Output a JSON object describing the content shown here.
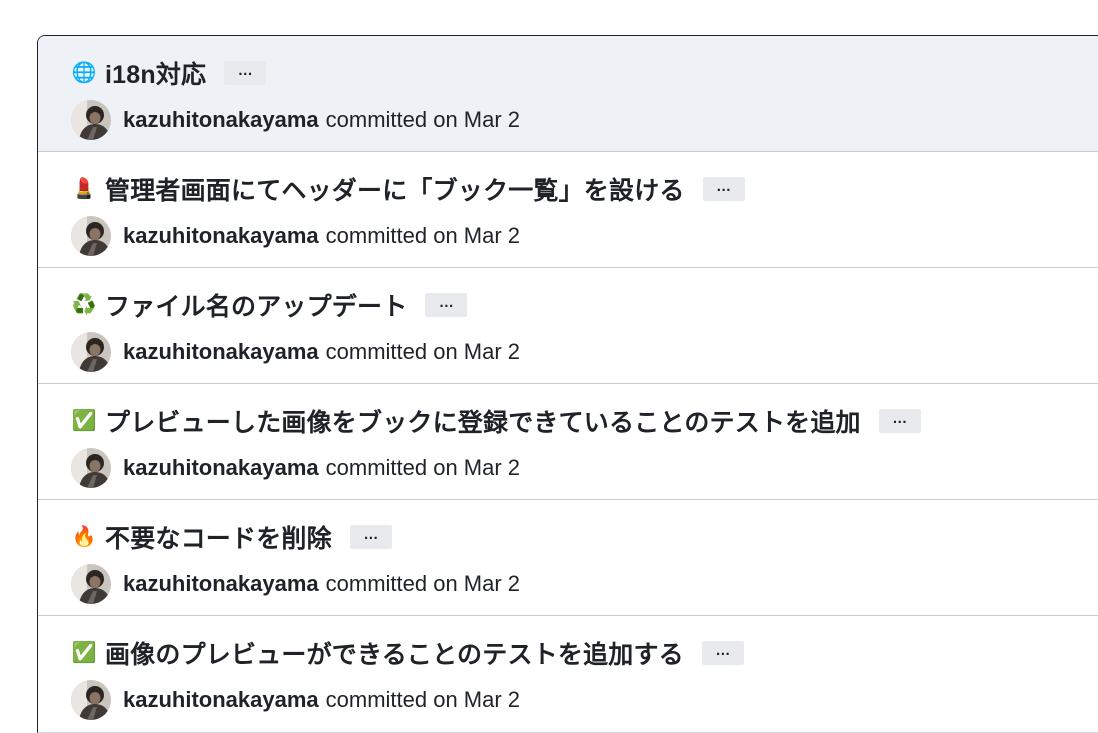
{
  "commits": [
    {
      "emoji": "🌐",
      "emoji_name": "globe-icon",
      "title": "i18n対応",
      "ellipsis": "…",
      "author": "kazuhitonakayama",
      "committed": "committed on Mar 2",
      "hovered": true
    },
    {
      "emoji": "💄",
      "emoji_name": "lipstick-icon",
      "title": "管理者画面にてヘッダーに「ブック一覧」を設ける",
      "ellipsis": "…",
      "author": "kazuhitonakayama",
      "committed": "committed on Mar 2",
      "hovered": false
    },
    {
      "emoji": "♻️",
      "emoji_name": "recycle-icon",
      "title": "ファイル名のアップデート",
      "ellipsis": "…",
      "author": "kazuhitonakayama",
      "committed": "committed on Mar 2",
      "hovered": false
    },
    {
      "emoji": "✅",
      "emoji_name": "check-mark-icon",
      "title": "プレビューした画像をブックに登録できていることのテストを追加",
      "ellipsis": "…",
      "author": "kazuhitonakayama",
      "committed": "committed on Mar 2",
      "hovered": false
    },
    {
      "emoji": "🔥",
      "emoji_name": "fire-icon",
      "title": "不要なコードを削除",
      "ellipsis": "…",
      "author": "kazuhitonakayama",
      "committed": "committed on Mar 2",
      "hovered": false
    },
    {
      "emoji": "✅",
      "emoji_name": "check-mark-icon",
      "title": "画像のプレビューができることのテストを追加する",
      "ellipsis": "…",
      "author": "kazuhitonakayama",
      "committed": "committed on Mar 2",
      "hovered": false
    }
  ],
  "colors": {
    "hover_bg": "#eef1f5",
    "border": "#c7ccd1",
    "text": "#1f2328",
    "ellipsis_bg": "#e8eaed"
  }
}
